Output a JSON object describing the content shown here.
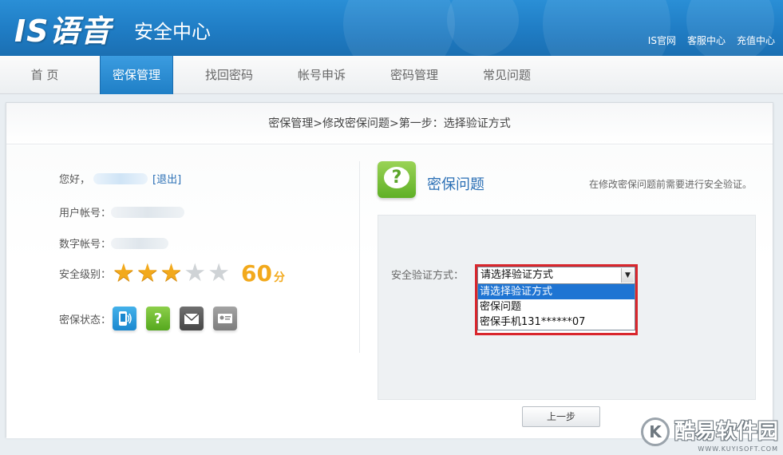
{
  "header": {
    "logo": "IS语音",
    "title": "安全中心",
    "links": [
      "IS官网",
      "客服中心",
      "充值中心"
    ]
  },
  "nav": {
    "items": [
      "首 页",
      "密保管理",
      "找回密码",
      "帐号申诉",
      "密码管理",
      "常见问题"
    ],
    "active_index": 1
  },
  "breadcrumb": "密保管理>修改密保问题>第一步：选择验证方式",
  "account": {
    "greeting": "您好，",
    "logout": "[退出]",
    "user_account_label": "用户帐号：",
    "digit_account_label": "数字帐号：",
    "security_level_label": "安全级别：",
    "stars_total": 5,
    "stars_on": 3,
    "score": "60",
    "score_unit": "分",
    "mibao_status_label": "密保状态：",
    "mibao_icons": [
      "phone-icon",
      "question-icon",
      "mail-icon",
      "id-card-icon"
    ]
  },
  "mibao_question": {
    "title": "密保问题",
    "hint": "在修改密保问题前需要进行安全验证。",
    "verify_label": "安全验证方式：",
    "select_value": "请选择验证方式",
    "options": [
      "请选择验证方式",
      "密保问题",
      "密保手机131******07"
    ],
    "selected_option_index": 0,
    "prev_button": "上一步"
  },
  "watermark": {
    "text": "酷易软件园",
    "sub": "WWW.KUYISOFT.COM"
  },
  "colors": {
    "header_blue": "#1f7cc4",
    "star_gold": "#f2a91c",
    "link_blue": "#2a6fb5",
    "highlight_red": "#d9262c",
    "option_selected": "#1e74d3"
  }
}
